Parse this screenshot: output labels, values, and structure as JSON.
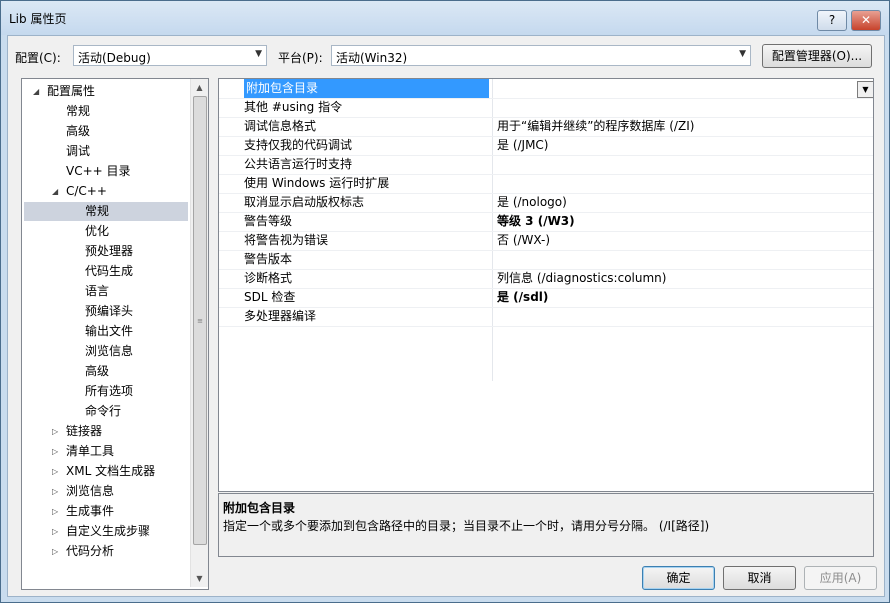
{
  "window": {
    "title": "Lib 属性页",
    "help_label": "?",
    "close_label": "✕"
  },
  "config": {
    "config_label": "配置(C):",
    "config_value": "活动(Debug)",
    "platform_label": "平台(P):",
    "platform_value": "活动(Win32)",
    "manager_button": "配置管理器(O)..."
  },
  "tree": {
    "items": [
      {
        "label": "配置属性",
        "twisty": "◢"
      },
      {
        "label": "常规",
        "twisty": ""
      },
      {
        "label": "高级",
        "twisty": ""
      },
      {
        "label": "调试",
        "twisty": ""
      },
      {
        "label": "VC++ 目录",
        "twisty": ""
      },
      {
        "label": "C/C++",
        "twisty": "◢"
      },
      {
        "label": "常规",
        "twisty": "",
        "selected": true
      },
      {
        "label": "优化",
        "twisty": ""
      },
      {
        "label": "预处理器",
        "twisty": ""
      },
      {
        "label": "代码生成",
        "twisty": ""
      },
      {
        "label": "语言",
        "twisty": ""
      },
      {
        "label": "预编译头",
        "twisty": ""
      },
      {
        "label": "输出文件",
        "twisty": ""
      },
      {
        "label": "浏览信息",
        "twisty": ""
      },
      {
        "label": "高级",
        "twisty": ""
      },
      {
        "label": "所有选项",
        "twisty": ""
      },
      {
        "label": "命令行",
        "twisty": ""
      },
      {
        "label": "链接器",
        "twisty": "▷"
      },
      {
        "label": "清单工具",
        "twisty": "▷"
      },
      {
        "label": "XML 文档生成器",
        "twisty": "▷"
      },
      {
        "label": "浏览信息",
        "twisty": "▷"
      },
      {
        "label": "生成事件",
        "twisty": "▷"
      },
      {
        "label": "自定义生成步骤",
        "twisty": "▷"
      },
      {
        "label": "代码分析",
        "twisty": "▷"
      }
    ]
  },
  "properties": [
    {
      "name": "附加包含目录",
      "value": "",
      "selected": true
    },
    {
      "name": "其他 #using 指令",
      "value": ""
    },
    {
      "name": "调试信息格式",
      "value": "用于“编辑并继续”的程序数据库 (/ZI)"
    },
    {
      "name": "支持仅我的代码调试",
      "value": "是 (/JMC)"
    },
    {
      "name": "公共语言运行时支持",
      "value": ""
    },
    {
      "name": "使用 Windows 运行时扩展",
      "value": ""
    },
    {
      "name": "取消显示启动版权标志",
      "value": "是 (/nologo)"
    },
    {
      "name": "警告等级",
      "value": "等级 3 (/W3)",
      "bold": true
    },
    {
      "name": "将警告视为错误",
      "value": "否 (/WX-)"
    },
    {
      "name": "警告版本",
      "value": ""
    },
    {
      "name": "诊断格式",
      "value": "列信息 (/diagnostics:column)"
    },
    {
      "name": "SDL 检查",
      "value": "是 (/sdl)",
      "bold": true
    },
    {
      "name": "多处理器编译",
      "value": ""
    }
  ],
  "description": {
    "title": "附加包含目录",
    "text": "指定一个或多个要添加到包含路径中的目录；当目录不止一个时，请用分号分隔。      (/I[路径])"
  },
  "buttons": {
    "ok": "确定",
    "cancel": "取消",
    "apply": "应用(A)"
  },
  "colors": {
    "selection": "#3399ff",
    "tree_selection": "#cdd3de",
    "frame": "#c9dcee"
  }
}
